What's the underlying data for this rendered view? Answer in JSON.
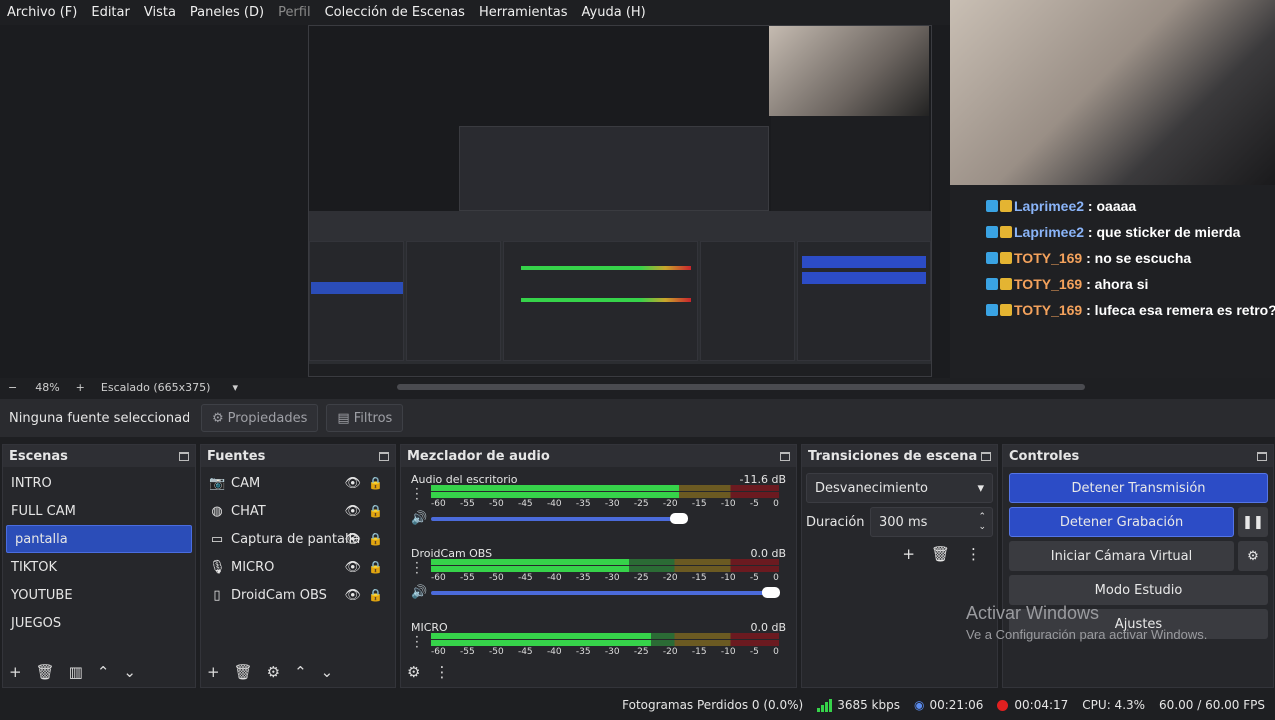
{
  "menu": [
    {
      "label": "Archivo (F)",
      "dim": false
    },
    {
      "label": "Editar",
      "dim": false
    },
    {
      "label": "Vista",
      "dim": false
    },
    {
      "label": "Paneles (D)",
      "dim": false
    },
    {
      "label": "Perfil",
      "dim": true
    },
    {
      "label": "Colección de Escenas",
      "dim": false
    },
    {
      "label": "Herramientas",
      "dim": false
    },
    {
      "label": "Ayuda (H)",
      "dim": false
    }
  ],
  "chat": [
    {
      "user": "Laprimee2",
      "msg": " : oaaaa",
      "type": "u1"
    },
    {
      "user": "Laprimee2",
      "msg": " : que sticker de mierda",
      "type": "u1"
    },
    {
      "user": "TOTY_169",
      "msg": " : no se escucha",
      "type": "u2"
    },
    {
      "user": "TOTY_169",
      "msg": " : ahora si",
      "type": "u2"
    },
    {
      "user": "TOTY_169",
      "msg": " : lufeca esa remera es retro?",
      "type": "u2"
    }
  ],
  "zoom": {
    "minus": "−",
    "value": "48%",
    "plus": "+",
    "scale": "Escalado (665x375)",
    "dropdown": "▾"
  },
  "source_toolbar": {
    "no_source": "Ninguna fuente seleccionada",
    "properties": "Propiedades",
    "filters": "Filtros"
  },
  "scenes": {
    "title": "Escenas",
    "items": [
      "INTRO",
      "FULL CAM",
      "pantalla",
      "TIKTOK",
      "YOUTUBE",
      "JUEGOS"
    ],
    "selected": 2
  },
  "sources": {
    "title": "Fuentes",
    "items": [
      {
        "label": "CAM",
        "icon": "camera-icon"
      },
      {
        "label": "CHAT",
        "icon": "globe-icon"
      },
      {
        "label": "Captura de pantalla",
        "icon": "monitor-icon"
      },
      {
        "label": "MICRO",
        "icon": "microphone-icon"
      },
      {
        "label": "DroidCam OBS",
        "icon": "file-icon"
      }
    ]
  },
  "mixer": {
    "title": "Mezclador de audio",
    "ticks": [
      "-60",
      "-55",
      "-50",
      "-45",
      "-40",
      "-35",
      "-30",
      "-25",
      "-20",
      "-15",
      "-10",
      "-5",
      "0"
    ],
    "channels": [
      {
        "name": "Audio del escritorio",
        "db": "-11.6 dB",
        "level": 0.18,
        "volume": 0.73
      },
      {
        "name": "DroidCam OBS",
        "db": "0.0 dB",
        "level": 0.27,
        "volume": 1.0
      },
      {
        "name": "MICRO",
        "db": "0.0 dB",
        "level": 0.23,
        "volume": 1.0
      }
    ]
  },
  "transitions": {
    "title": "Transiciones de escena",
    "type": "Desvanecimiento",
    "duration_label": "Duración",
    "duration": "300 ms"
  },
  "controls": {
    "title": "Controles",
    "stop_stream": "Detener Transmisión",
    "stop_record": "Detener Grabación",
    "virtual_cam": "Iniciar Cámara Virtual",
    "studio": "Modo Estudio",
    "settings": "Ajustes"
  },
  "watermark": {
    "title": "Activar Windows",
    "subtitle": "Ve a Configuración para activar Windows."
  },
  "status": {
    "dropped": "Fotogramas Perdidos 0 (0.0%)",
    "bitrate": "3685 kbps",
    "stream_time": "00:21:06",
    "record_time": "00:04:17",
    "cpu": "CPU: 4.3%",
    "fps": "60.00 / 60.00 FPS"
  },
  "colors": {
    "accent": "#2c4cc6",
    "selected": "#2b4db8",
    "meter_green": "#36d34a",
    "meter_yellow": "#c9a52c",
    "meter_red": "#c9242c"
  }
}
